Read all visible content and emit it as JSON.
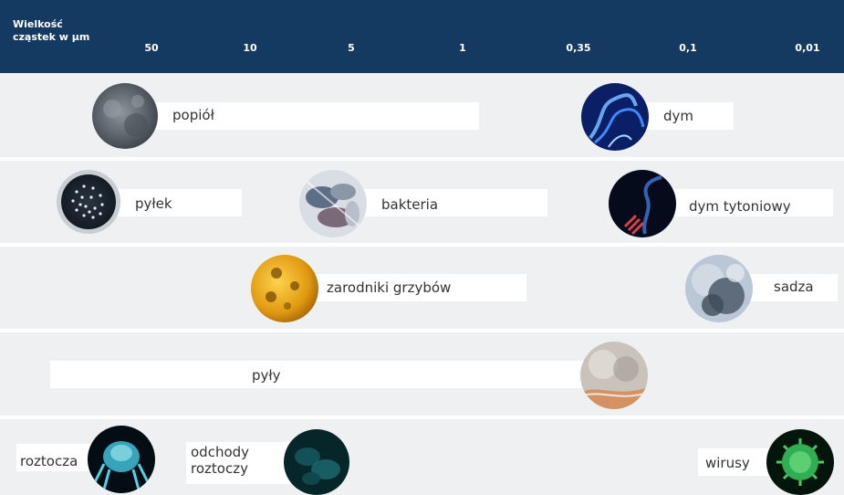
{
  "header": {
    "title": "Wielkość\ncząstek w µm",
    "scale": [
      "50",
      "10",
      "5",
      "1",
      "0,35",
      "0,1",
      "0,01"
    ]
  },
  "particles": {
    "popiol": "popiół",
    "dym": "dym",
    "pylek": "pyłek",
    "bakteria": "bakteria",
    "dym_tytoniowy": "dym tytoniowy",
    "zarodniki": "zarodniki grzybów",
    "sadza": "sadza",
    "pyly": "pyły",
    "roztocza": "roztocza",
    "odchody": "odchody\nroztoczy",
    "wirusy": "wirusy"
  },
  "colors": {
    "header": "#153a62",
    "background": "#eff0f1",
    "bar": "#ffffff",
    "label": "#333333"
  }
}
